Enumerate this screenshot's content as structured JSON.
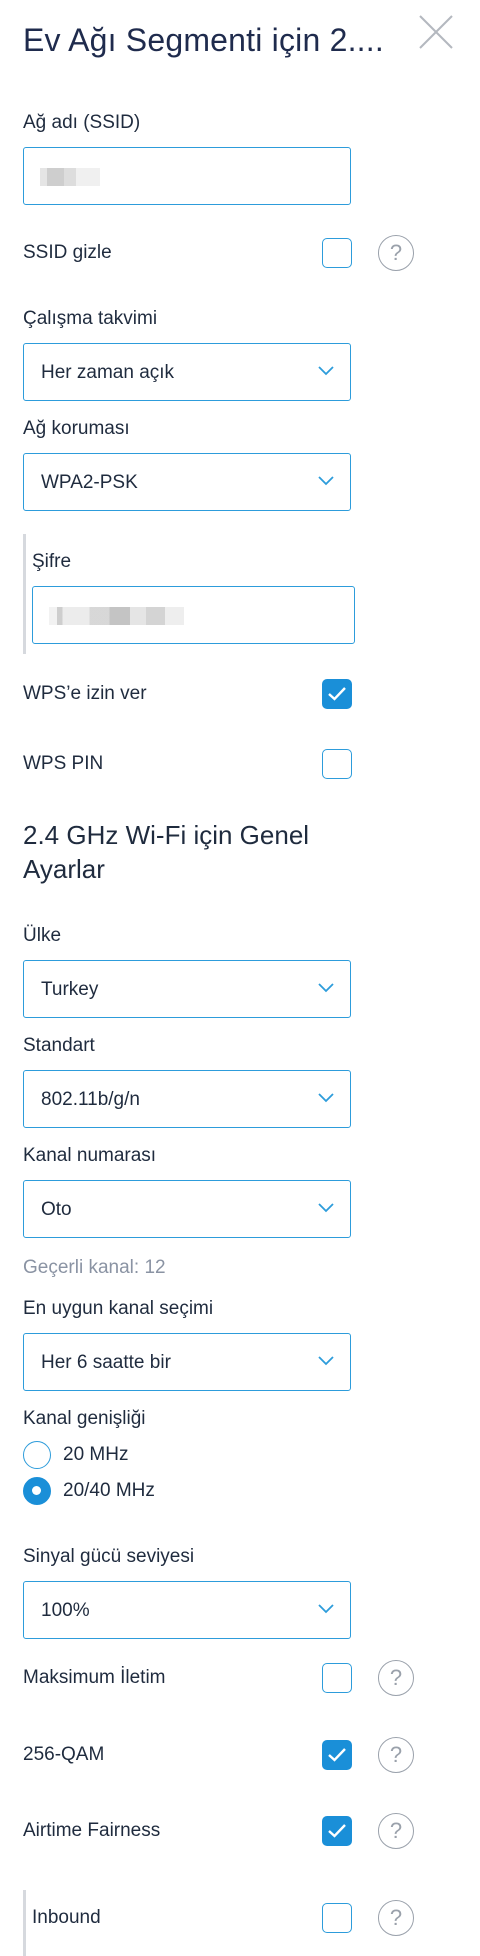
{
  "header": {
    "title": "Ev Ağı Segmenti için 2...."
  },
  "ssid": {
    "label": "Ağ adı (SSID)"
  },
  "hide_ssid": {
    "label": "SSID gizle",
    "checked": false
  },
  "schedule": {
    "label": "Çalışma takvimi",
    "value": "Her zaman açık"
  },
  "protection": {
    "label": "Ağ koruması",
    "value": "WPA2-PSK"
  },
  "password": {
    "label": "Şifre"
  },
  "wps": {
    "label": "WPS’e izin ver",
    "checked": true
  },
  "wps_pin": {
    "label": "WPS PIN",
    "checked": false
  },
  "general": {
    "title": "2.4 GHz Wi-Fi için Genel Ayarlar"
  },
  "country": {
    "label": "Ülke",
    "value": "Turkey"
  },
  "standard": {
    "label": "Standart",
    "value": "802.11b/g/n"
  },
  "channel": {
    "label": "Kanal numarası",
    "value": "Oto",
    "current": "Geçerli kanal: 12"
  },
  "best_channel": {
    "label": "En uygun kanal seçimi",
    "value": "Her 6 saatte bir"
  },
  "bandwidth": {
    "label": "Kanal genişliği",
    "options": [
      {
        "label": "20 MHz",
        "selected": false
      },
      {
        "label": "20/40 MHz",
        "selected": true
      }
    ]
  },
  "signal": {
    "label": "Sinyal gücü seviyesi",
    "value": "100%"
  },
  "max_transmit": {
    "label": "Maksimum İletim",
    "checked": false
  },
  "qam": {
    "label": "256-QAM",
    "checked": true
  },
  "airtime": {
    "label": "Airtime Fairness",
    "checked": true
  },
  "inbound": {
    "label": "Inbound",
    "checked": false
  },
  "icons": {
    "help": "?",
    "close": "close-icon",
    "chevron": "chevron-down-icon",
    "check": "check-icon"
  },
  "colors": {
    "accent": "#1a8fd8",
    "border": "#2d9cdb",
    "text": "#1f2b3e",
    "muted": "#8a93a3"
  }
}
